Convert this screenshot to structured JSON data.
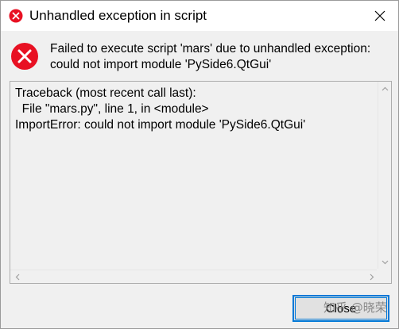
{
  "window": {
    "title": "Unhandled exception in script"
  },
  "message": {
    "text": "Failed to execute script 'mars' due to unhandled exception: could not import module 'PySide6.QtGui'"
  },
  "details": {
    "lines": [
      "Traceback (most recent call last):",
      "  File \"mars.py\", line 1, in <module>",
      "ImportError: could not import module 'PySide6.QtGui'"
    ]
  },
  "buttons": {
    "close_label": "Close"
  },
  "watermark": {
    "text": "知乎 @晓荣"
  },
  "colors": {
    "error_red": "#e81123",
    "focus_blue": "#0078d7"
  },
  "icons": {
    "title": "error-icon",
    "message": "error-icon",
    "close": "close-icon"
  }
}
